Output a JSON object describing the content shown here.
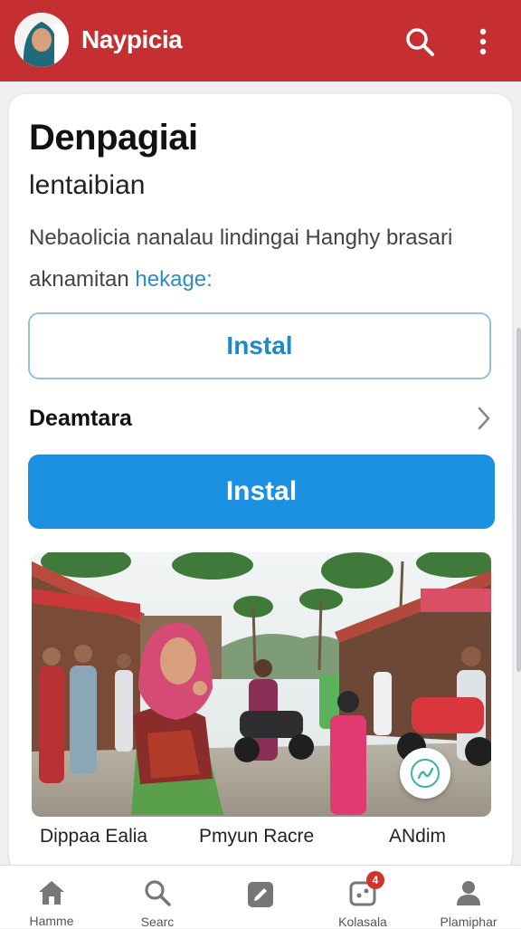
{
  "app_bar": {
    "title": "Naypicia",
    "search_icon": "search-icon",
    "more_icon": "more-vert-icon"
  },
  "card": {
    "heading": "Denpagiai",
    "subheading": "lentaibian",
    "description": "Nebaolicia nanalau lindingai Hanghy brasari aknamitan",
    "description_link": "hekage:",
    "outline_button_label": "Instal",
    "row_label": "Deamtara",
    "solid_button_label": "Instal",
    "photo_captions": [
      "Dippaa Ealia",
      "Pmyun Racre",
      "ANdim"
    ]
  },
  "bottom_nav": {
    "items": [
      {
        "label": "Hamme",
        "icon": "home-icon"
      },
      {
        "label": "Searc",
        "icon": "search-icon"
      },
      {
        "label": "",
        "icon": "edit-icon"
      },
      {
        "label": "Kolasala",
        "icon": "notification-icon",
        "badge": "4"
      },
      {
        "label": "Plamiphar",
        "icon": "profile-icon"
      }
    ]
  },
  "colors": {
    "appbar": "#c62f32",
    "primary_button": "#1b8fe0",
    "link": "#2c8dc3"
  }
}
